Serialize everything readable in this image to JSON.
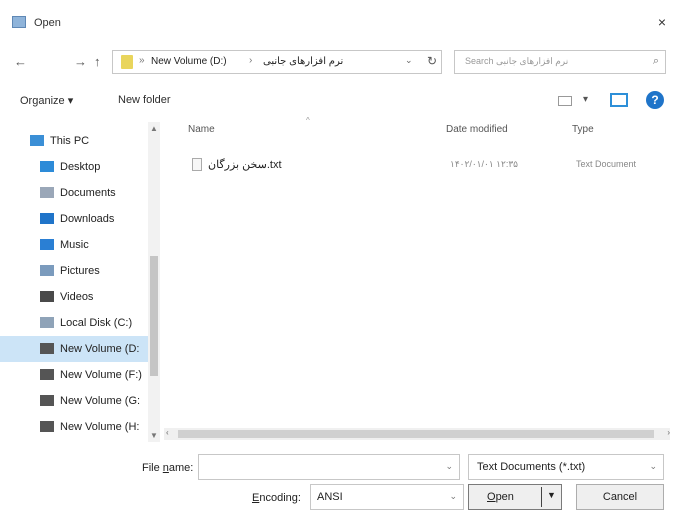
{
  "window": {
    "title": "Open",
    "close_glyph": "×"
  },
  "nav_buttons": {
    "back": "←",
    "forward": "→",
    "up": "↑"
  },
  "address": {
    "separator": "»",
    "crumb_1": "New Volume (D:)",
    "crumb_separator": "›",
    "crumb_2": "نرم افزارهای جانبی",
    "dropdown_glyph": "⌄",
    "refresh_glyph": "↻"
  },
  "search": {
    "placeholder": "Search نرم افزارهای جانبی",
    "icon_glyph": "⌕"
  },
  "toolbar": {
    "organize": "Organize ▾",
    "new_folder": "New folder",
    "help": "?"
  },
  "nav_pane": {
    "items": [
      {
        "label": "This PC",
        "icon": "pc-icon",
        "color": "#3b8fd6"
      },
      {
        "label": "Desktop",
        "icon": "desktop-icon",
        "color": "#2d8bd8"
      },
      {
        "label": "Documents",
        "icon": "documents-icon",
        "color": "#9aa7b8"
      },
      {
        "label": "Downloads",
        "icon": "downloads-icon",
        "color": "#1f74c9"
      },
      {
        "label": "Music",
        "icon": "music-icon",
        "color": "#2a7fd4"
      },
      {
        "label": "Pictures",
        "icon": "pictures-icon",
        "color": "#7b9bbd"
      },
      {
        "label": "Videos",
        "icon": "videos-icon",
        "color": "#4a4a4a"
      },
      {
        "label": "Local Disk (C:)",
        "icon": "local-disk-icon",
        "color": "#8fa3b8"
      },
      {
        "label": "New Volume (D:",
        "icon": "drive-icon",
        "color": "#555555",
        "selected": true
      },
      {
        "label": "New Volume (F:)",
        "icon": "drive-icon",
        "color": "#555555"
      },
      {
        "label": "New Volume (G:",
        "icon": "drive-icon",
        "color": "#555555"
      },
      {
        "label": "New Volume (H:",
        "icon": "drive-icon",
        "color": "#555555"
      }
    ]
  },
  "file_list": {
    "columns": {
      "name": "Name",
      "date_modified": "Date modified",
      "type": "Type"
    },
    "sort_glyph": "^",
    "rows": [
      {
        "name": "سخن بزرگان.txt",
        "date_modified": "۱۴۰۲/۰۱/۰۱ ۱۲:۳۵",
        "type": "Text Document"
      }
    ]
  },
  "footer": {
    "file_name_label_pre": "File ",
    "file_name_label_u": "n",
    "file_name_label_post": "ame:",
    "file_name_value": "",
    "file_type": "Text Documents (*.txt)",
    "encoding_label_u": "E",
    "encoding_label_post": "ncoding:",
    "encoding_value": "ANSI",
    "open_u": "O",
    "open_post": "pen",
    "cancel": "Cancel"
  },
  "colors": {
    "selection": "#cce4f7",
    "accent": "#1f74c9"
  }
}
